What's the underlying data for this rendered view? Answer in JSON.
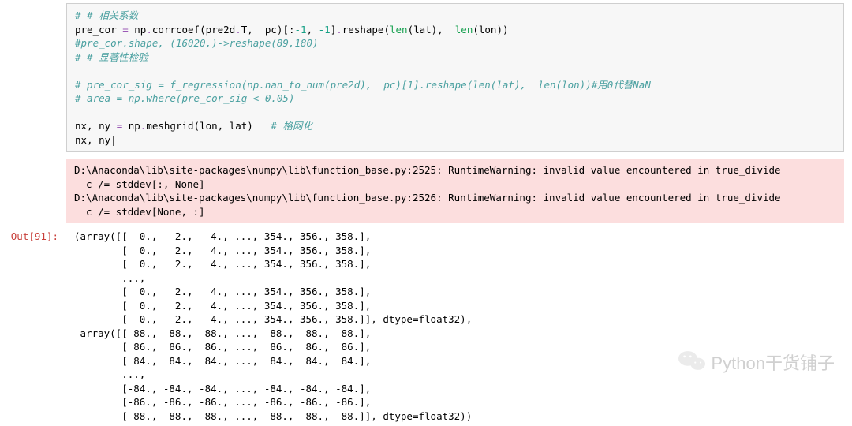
{
  "code": {
    "l1": "# # 相关系数",
    "l2a": "pre_cor ",
    "l2b": "=",
    "l2c": " np",
    "l2d": ".",
    "l2e": "corrcoef",
    "l2f": "(pre2d",
    "l2g": ".",
    "l2h": "T",
    "l2i": ",  pc)",
    "l2j": "[:",
    "l2k": "-1",
    "l2l": ", ",
    "l2m": "-1",
    "l2n": "]",
    "l2o": ".",
    "l2p": "reshape",
    "l2q": "(",
    "l2r": "len",
    "l2s": "(lat),  ",
    "l2t": "len",
    "l2u": "(lon))",
    "l3": "#pre_cor.shape, (16020,)->reshape(89,180)",
    "l4": "# # 显著性检验",
    "l5": "",
    "l6": "# pre_cor_sig = f_regression(np.nan_to_num(pre2d),  pc)[1].reshape(len(lat),  len(lon))#用0代替NaN",
    "l7": "# area = np.where(pre_cor_sig < 0.05)",
    "l8": "",
    "l9a": "nx, ny ",
    "l9b": "=",
    "l9c": " np",
    "l9d": ".",
    "l9e": "meshgrid",
    "l9f": "(lon, lat)   ",
    "l9g": "# 格网化",
    "l10": "nx, ny|"
  },
  "stderr": {
    "l1": "D:\\Anaconda\\lib\\site-packages\\numpy\\lib\\function_base.py:2525: RuntimeWarning: invalid value encountered in true_divide",
    "l2": "  c /= stddev[:, None]",
    "l3": "D:\\Anaconda\\lib\\site-packages\\numpy\\lib\\function_base.py:2526: RuntimeWarning: invalid value encountered in true_divide",
    "l4": "  c /= stddev[None, :]"
  },
  "out_label": "Out[91]:",
  "output": {
    "l1": "(array([[  0.,   2.,   4., ..., 354., 356., 358.],",
    "l2": "        [  0.,   2.,   4., ..., 354., 356., 358.],",
    "l3": "        [  0.,   2.,   4., ..., 354., 356., 358.],",
    "l4": "        ...,",
    "l5": "        [  0.,   2.,   4., ..., 354., 356., 358.],",
    "l6": "        [  0.,   2.,   4., ..., 354., 356., 358.],",
    "l7": "        [  0.,   2.,   4., ..., 354., 356., 358.]], dtype=float32),",
    "l8": " array([[ 88.,  88.,  88., ...,  88.,  88.,  88.],",
    "l9": "        [ 86.,  86.,  86., ...,  86.,  86.,  86.],",
    "l10": "        [ 84.,  84.,  84., ...,  84.,  84.,  84.],",
    "l11": "        ...,",
    "l12": "        [-84., -84., -84., ..., -84., -84., -84.],",
    "l13": "        [-86., -86., -86., ..., -86., -86., -86.],",
    "l14": "        [-88., -88., -88., ..., -88., -88., -88.]], dtype=float32))"
  },
  "watermark": "Python干货铺子"
}
